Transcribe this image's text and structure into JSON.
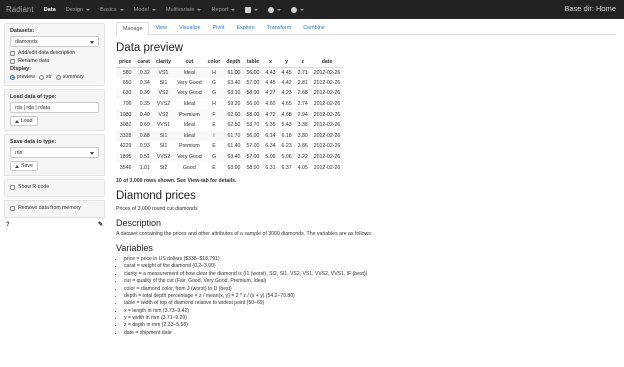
{
  "navbar": {
    "brand": "Radiant",
    "items": [
      {
        "label": "Data",
        "active": true,
        "caret": false
      },
      {
        "label": "Design",
        "active": false,
        "caret": true
      },
      {
        "label": "Basics",
        "active": false,
        "caret": true
      },
      {
        "label": "Model",
        "active": false,
        "caret": true
      },
      {
        "label": "Multivariate",
        "active": false,
        "caret": true
      },
      {
        "label": "Report",
        "active": false,
        "caret": true
      }
    ],
    "icons": [
      "save-icon",
      "settings-icon",
      "help-icon"
    ],
    "base_dir": "Base dir: Home"
  },
  "sidebar": {
    "datasets_label": "Datasets:",
    "dataset_value": "diamonds",
    "add_edit_label": "Add/edit data description",
    "rename_label": "Rename data",
    "display_label": "Display:",
    "display_options": [
      "preview",
      "str",
      "summary"
    ],
    "display_selected": "preview",
    "load_type_label": "Load data of type:",
    "load_type_value": "rds | rda | rdata",
    "load_button": "Load",
    "save_type_label": "Save data to type:",
    "save_type_value": "rds",
    "save_button": "Save",
    "show_rcode_label": "Show R-code",
    "remove_label": "Remove data from memory",
    "help_glyph": "?",
    "edit_glyph": "✎"
  },
  "main": {
    "tabs": [
      "Manage",
      "View",
      "Visualize",
      "Pivot",
      "Explore",
      "Transform",
      "Combine"
    ],
    "active_tab": "Manage",
    "preview_title": "Data preview",
    "columns": [
      "price",
      "carat",
      "clarity",
      "cut",
      "color",
      "depth",
      "table",
      "x",
      "y",
      "z",
      "date"
    ],
    "rows": [
      [
        "580",
        "0.32",
        "VS1",
        "Ideal",
        "H",
        "61.00",
        "56.00",
        "4.43",
        "4.45",
        "2.71",
        "2012-02-26"
      ],
      [
        "650",
        "0.34",
        "SI1",
        "Very Good",
        "G",
        "63.40",
        "57.00",
        "4.45",
        "4.42",
        "2.81",
        "2012-02-26"
      ],
      [
        "630",
        "0.30",
        "VS2",
        "Very Good",
        "G",
        "63.10",
        "58.00",
        "4.27",
        "4.23",
        "2.68",
        "2012-02-26"
      ],
      [
        "706",
        "0.35",
        "VVS2",
        "Ideal",
        "H",
        "59.20",
        "56.00",
        "4.60",
        "4.65",
        "2.74",
        "2012-02-26"
      ],
      [
        "1080",
        "0.40",
        "VS2",
        "Premium",
        "F",
        "62.60",
        "58.00",
        "4.72",
        "4.68",
        "2.94",
        "2012-02-26"
      ],
      [
        "3082",
        "0.60",
        "VVS1",
        "Ideal",
        "E",
        "62.50",
        "53.70",
        "5.35",
        "5.43",
        "3.38",
        "2012-02-26"
      ],
      [
        "3328",
        "0.88",
        "SI1",
        "Ideal",
        "I",
        "61.70",
        "56.00",
        "6.14",
        "6.18",
        "3.80",
        "2012-02-26"
      ],
      [
        "4229",
        "0.93",
        "SI1",
        "Premium",
        "E",
        "61.40",
        "57.00",
        "6.34",
        "6.23",
        "3.86",
        "2012-02-26"
      ],
      [
        "1895",
        "0.51",
        "VVS2",
        "Very Good",
        "G",
        "63.40",
        "57.00",
        "5.09",
        "5.06",
        "3.22",
        "2012-02-26"
      ],
      [
        "3546",
        "1.01",
        "SI2",
        "Good",
        "E",
        "63.90",
        "58.00",
        "6.31",
        "6.37",
        "4.05",
        "2012-02-26"
      ]
    ],
    "rows_note": "10 of 3,000 rows shown. See View-tab for details.",
    "desc_title": "Diamond prices",
    "desc_subtitle": "Prices of 3,000 round cut diamonds",
    "description_heading": "Description",
    "description_text": "A dataset containing the prices and other attributes of a sample of 3000 diamonds. The variables are as follows:",
    "variables_heading": "Variables",
    "variables": [
      "price = price in US dollars ($338–$18,791)",
      "carat = weight of the diamond (0.2–3.00)",
      "clarity = a measurement of how clear the diamond is (I1 (worst), SI2, SI1, VS2, VS1, VVS2, VVS1, IF (best))",
      "cut = quality of the cut (Fair, Good, Very Good, Premium, Ideal)",
      "color = diamond color, from J (worst) to D (best)",
      "depth = total depth percentage = z / mean(x, y) = 2 * z / (x + y) (54.2–70.80)",
      "table = width of top of diamond relative to widest point (50–69)",
      "x = length in mm (3.73–9.42)",
      "y = width in mm (3.71–9.29)",
      "z = depth in mm (2.33–5.58)",
      "date = shipment date"
    ]
  }
}
